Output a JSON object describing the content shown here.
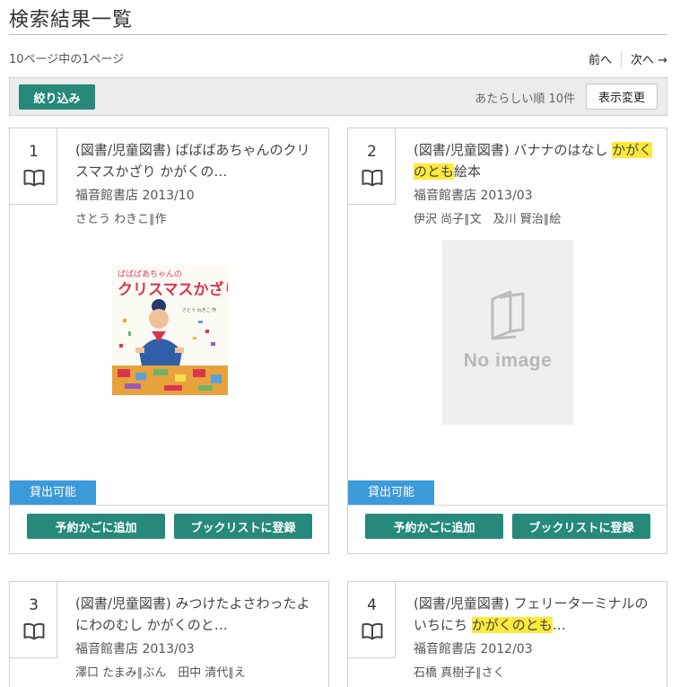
{
  "header": {
    "title": "検索結果一覧"
  },
  "pagination": {
    "info": "10ページ中の1ページ",
    "prev": "前へ",
    "next": "次へ →"
  },
  "toolbar": {
    "filter_label": "絞り込み",
    "sort_text": "あたらしい順 10件",
    "display_label": "表示変更"
  },
  "colors": {
    "accent_green": "#26897a",
    "badge_blue": "#3b9ad9",
    "highlight": "#ffe93c"
  },
  "results": [
    {
      "num": "1",
      "title_pre": "(図書/児童図書) ばばばあちゃんのクリスマスかざり ",
      "title_hl": "",
      "title_post": "かがくの…",
      "publisher": "福音館書店 2013/10",
      "author": "さとう わきこ∥作",
      "has_cover": true,
      "cover_title_a": "ばばばあちゃんの",
      "cover_title_b": "クリスマスかざり",
      "cover_author": "さとう わきこ 作",
      "status": "貸出可能",
      "reserve_label": "予約かごに追加",
      "booklist_label": "ブックリストに登録"
    },
    {
      "num": "2",
      "title_pre": "(図書/児童図書) バナナのはなし ",
      "title_hl": "かがくのとも",
      "title_post": "絵本",
      "publisher": "福音館書店 2013/03",
      "author": "伊沢 尚子∥文　及川 賢治∥絵",
      "has_cover": false,
      "no_image_text": "No image",
      "status": "貸出可能",
      "reserve_label": "予約かごに追加",
      "booklist_label": "ブックリストに登録"
    },
    {
      "num": "3",
      "title_pre": "(図書/児童図書) みつけたよさわったよにわのむし かがくのと…",
      "title_hl": "",
      "title_post": "",
      "publisher": "福音館書店 2013/03",
      "author": "澤口 たまみ∥ぶん　田中 清代∥え"
    },
    {
      "num": "4",
      "title_pre": "(図書/児童図書) フェリーターミナルのいちにち ",
      "title_hl": "かがくのとも",
      "title_post": "…",
      "publisher": "福音館書店 2012/03",
      "author": "石橋 真樹子∥さく"
    }
  ]
}
